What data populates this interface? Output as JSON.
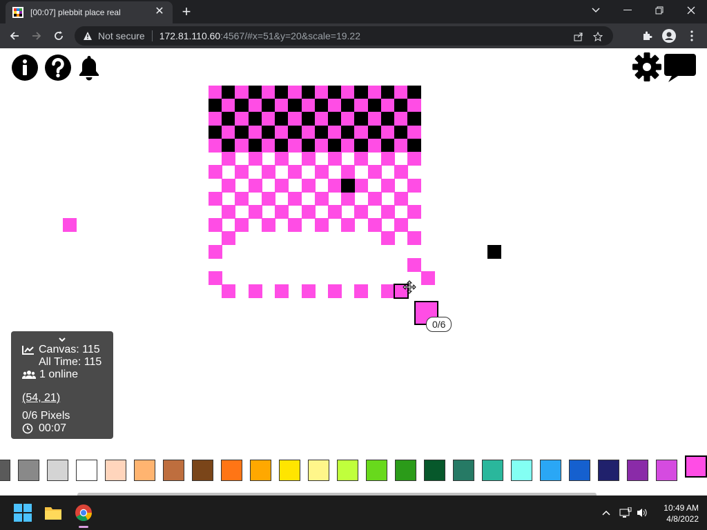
{
  "browser": {
    "tab_title": "[00:07] plebbit place real",
    "tab_close": "✕",
    "new_tab": "+",
    "security_label": "Not secure",
    "url_host": "172.81.110.60",
    "url_path": ":4567/#x=51&y=20&scale=19.22"
  },
  "stats": {
    "toggle": "⌄",
    "canvas": "Canvas: 115",
    "all_time": "All Time: 115",
    "online": "1 online",
    "coords": "(54, 21)",
    "pixels": "0/6 Pixels",
    "timer": "00:07"
  },
  "cursor_bubble": "0/6",
  "selected_color": "#ff4de5",
  "palette": [
    "#5a5a5a",
    "#898989",
    "#d4d4d4",
    "#ffffff",
    "#ffd5bc",
    "#ffb470",
    "#be6e3e",
    "#7a4519",
    "#ff7515",
    "#ffa800",
    "#ffe500",
    "#fff68a",
    "#c0ff3c",
    "#68d91c",
    "#2b9b19",
    "#07582b",
    "#267a65",
    "#2ab79c",
    "#83fff3",
    "#2aa7f5",
    "#1560cf",
    "#20216c",
    "#8a2ba8",
    "#d54be0",
    "#ff4de5"
  ],
  "taskbar": {
    "time": "10:49 AM",
    "date": "4/8/2022"
  }
}
